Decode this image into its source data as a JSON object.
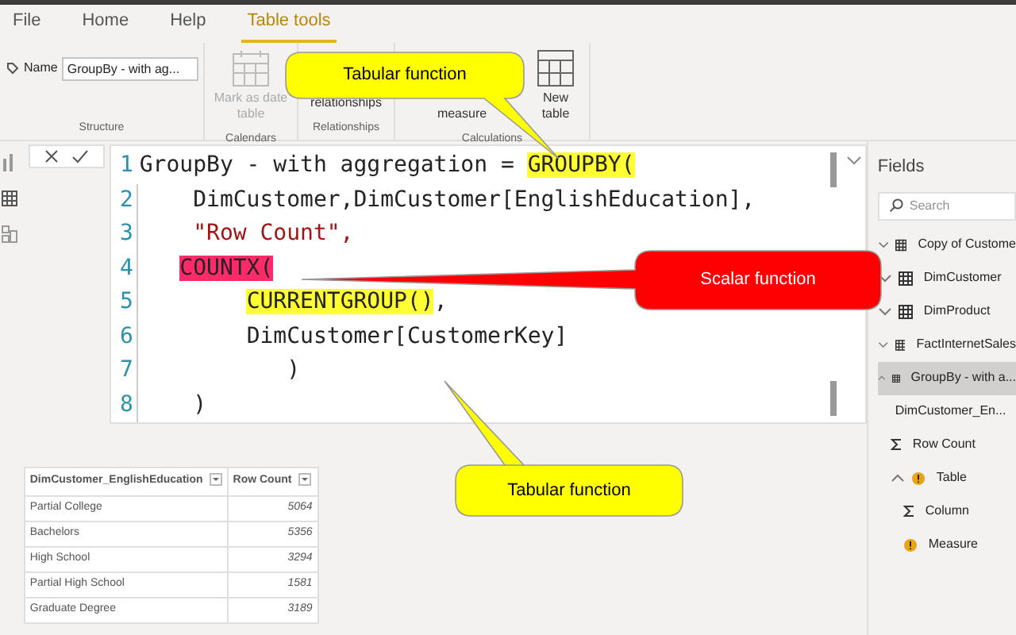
{
  "tabs": [
    {
      "label": "File",
      "selected": false
    },
    {
      "label": "Home",
      "selected": false
    },
    {
      "label": "Help",
      "selected": false
    },
    {
      "label": "Table tools",
      "selected": true
    }
  ],
  "ribbon": {
    "name_label": "Name",
    "name_value": "GroupBy - with ag...",
    "groups": [
      {
        "label": "Structure"
      },
      {
        "label": "Calendars",
        "buttons": [
          {
            "label": "Mark as date table",
            "kind": "calendar",
            "disabled": true
          }
        ]
      },
      {
        "label": "Relationships",
        "buttons": [
          {
            "label": "relationships",
            "kind": "covered",
            "disabled": false
          }
        ]
      },
      {
        "label": "Calculations",
        "buttons": [
          {
            "label": "measure",
            "kind": "covered",
            "disabled": false
          },
          {
            "label": "New table",
            "kind": "grid",
            "disabled": false
          }
        ]
      }
    ]
  },
  "editor": {
    "lines": [
      {
        "number": "1",
        "segments": [
          {
            "text": "GroupBy - with aggregation = ",
            "kind": "plain"
          },
          {
            "text": "GROUPBY(",
            "kind": "marked"
          }
        ]
      },
      {
        "number": "2",
        "segments": [
          {
            "text": "DimCustomer,DimCustomer[EnglishEducation],",
            "kind": "plain"
          }
        ]
      },
      {
        "number": "3",
        "segments": [
          {
            "text": "\"Row Count\",",
            "kind": "string"
          }
        ]
      },
      {
        "number": "4",
        "segments": [
          {
            "text": "COUNTX(",
            "kind": "alert"
          }
        ]
      },
      {
        "number": "5",
        "segments": [
          {
            "text": "CURRENTGROUP()",
            "kind": "marked"
          },
          {
            "text": ",",
            "kind": "plain"
          }
        ]
      },
      {
        "number": "6",
        "segments": [
          {
            "text": "DimCustomer[CustomerKey]",
            "kind": "plain"
          }
        ]
      },
      {
        "number": "7",
        "segments": [
          {
            "text": ")",
            "kind": "plain"
          }
        ]
      },
      {
        "number": "8",
        "segments": [
          {
            "text": ")",
            "kind": "plain"
          }
        ]
      }
    ]
  },
  "table": {
    "columns": [
      "DimCustomer_EnglishEducation",
      "Row Count"
    ],
    "rows": [
      [
        "Partial College",
        "5064"
      ],
      [
        "Bachelors",
        "5356"
      ],
      [
        "High School",
        "3294"
      ],
      [
        "Partial High School",
        "1581"
      ],
      [
        "Graduate Degree",
        "3189"
      ]
    ]
  },
  "fields": {
    "title": "Fields",
    "search_placeholder": "Search",
    "items": [
      {
        "label": "Copy of Custome",
        "kind": "table",
        "expanded": false,
        "selected": false
      },
      {
        "label": "DimCustomer",
        "kind": "table",
        "expanded": false,
        "selected": false
      },
      {
        "label": "DimProduct",
        "kind": "table",
        "expanded": false,
        "selected": false
      },
      {
        "label": "FactInternetSales",
        "kind": "table",
        "expanded": false,
        "selected": false
      },
      {
        "label": "GroupBy - with a...",
        "kind": "table",
        "expanded": true,
        "selected": true,
        "children": [
          {
            "label": "DimCustomer_En...",
            "kind": "field",
            "expanded": false,
            "selected": false
          },
          {
            "label": "Row Count",
            "kind": "measure",
            "expanded": false,
            "selected": false
          },
          {
            "label": "Table",
            "kind": "warning",
            "expanded": true,
            "selected": false,
            "children": [
              {
                "label": "Column",
                "kind": "measure",
                "expanded": false,
                "selected": false
              },
              {
                "label": "Measure",
                "kind": "warning",
                "expanded": false,
                "selected": false
              }
            ]
          }
        ]
      }
    ]
  },
  "callouts": [
    {
      "text": "Tabular function",
      "color": "#ffff00"
    },
    {
      "text": "Scalar function",
      "color": "#ff0000"
    },
    {
      "text": "Tabular function",
      "color": "#ffff00"
    }
  ]
}
